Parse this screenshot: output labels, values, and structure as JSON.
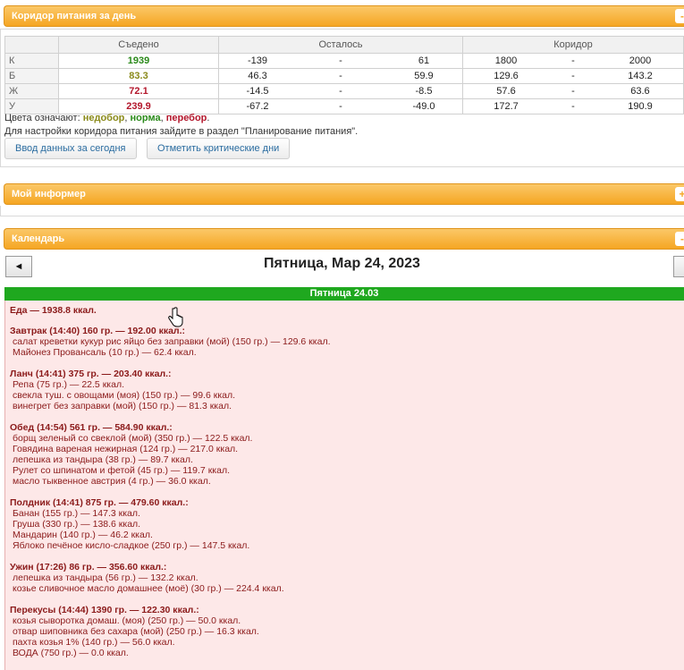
{
  "corridor_panel": {
    "title": "Коридор питания за день",
    "toggle": "-",
    "headers": [
      "Съедено",
      "Осталось",
      "Коридор"
    ],
    "rows": [
      {
        "label": "К",
        "eaten": "1939",
        "eaten_color": "#2a8a1a",
        "left_from": "-139",
        "sep1": "-",
        "left_to": "61",
        "corr_from": "1800",
        "sep2": "-",
        "corr_to": "2000"
      },
      {
        "label": "Б",
        "eaten": "83.3",
        "eaten_color": "#8a8a1a",
        "left_from": "46.3",
        "sep1": "-",
        "left_to": "59.9",
        "corr_from": "129.6",
        "sep2": "-",
        "corr_to": "143.2"
      },
      {
        "label": "Ж",
        "eaten": "72.1",
        "eaten_color": "#b3172c",
        "left_from": "-14.5",
        "sep1": "-",
        "left_to": "-8.5",
        "corr_from": "57.6",
        "sep2": "-",
        "corr_to": "63.6"
      },
      {
        "label": "У",
        "eaten": "239.9",
        "eaten_color": "#b3172c",
        "left_from": "-67.2",
        "sep1": "-",
        "left_to": "-49.0",
        "corr_from": "172.7",
        "sep2": "-",
        "corr_to": "190.9"
      }
    ],
    "legend_prefix": "Цвета означают: ",
    "legend_under": "недобор",
    "legend_sep1": ", ",
    "legend_norm": "норма",
    "legend_sep2": ", ",
    "legend_over": "перебор",
    "legend_end": ".",
    "settings_note": "Для настройки коридора питания зайдите в раздел \"Планирование питания\".",
    "btn_today": "Ввод данных за сегодня",
    "btn_critical": "Отметить критические дни"
  },
  "informer_panel": {
    "title": "Мой информер",
    "toggle": "+"
  },
  "calendar_panel": {
    "title": "Календарь",
    "toggle": "-",
    "prev": "◄",
    "date_title": "Пятница, Мар 24, 2023",
    "day_label": "Пятница 24.03",
    "total": "Еда — 1938.8 ккал.",
    "meals": [
      {
        "title": "Завтрак (14:40) 160 гр. — 192.00 ккал.:",
        "items": [
          "салат креветки кукур рис яйцо без заправки (мой) (150 гр.) — 129.6 ккал.",
          "Майонез Провансаль (10 гр.) — 62.4 ккал."
        ]
      },
      {
        "title": "Ланч (14:41) 375 гр. — 203.40 ккал.:",
        "items": [
          "Репа (75 гр.) — 22.5 ккал.",
          "свекла туш. с овощами (моя) (150 гр.) — 99.6 ккал.",
          "винегрет без заправки (мой) (150 гр.) — 81.3 ккал."
        ]
      },
      {
        "title": "Обед (14:54) 561 гр. — 584.90 ккал.:",
        "items": [
          "борщ зеленый со свеклой (мой) (350 гр.) — 122.5 ккал.",
          "Говядина вареная нежирная (124 гр.) — 217.0 ккал.",
          "лепешка из тандыра (38 гр.) — 89.7 ккал.",
          "Рулет со шпинатом и фетой (45 гр.) — 119.7 ккал.",
          "масло тыквенное австрия (4 гр.) — 36.0 ккал."
        ]
      },
      {
        "title": "Полдник (14:41) 875 гр. — 479.60 ккал.:",
        "items": [
          "Банан (155 гр.) — 147.3 ккал.",
          "Груша (330 гр.) — 138.6 ккал.",
          "Мандарин (140 гр.) — 46.2 ккал.",
          "Яблоко печёное кисло-сладкое (250 гр.) — 147.5 ккал."
        ]
      },
      {
        "title": "Ужин (17:26) 86 гр. — 356.60 ккал.:",
        "items": [
          "лепешка из тандыра (56 гр.) — 132.2 ккал.",
          "козье сливочное масло домашнее (моё) (30 гр.) — 224.4 ккал."
        ]
      },
      {
        "title": "Перекусы (14:44) 1390 гр. — 122.30 ккал.:",
        "items": [
          "козья сыворотка домаш. (моя) (250 гр.) — 50.0 ккал.",
          "отвар шиповника без сахара (мой) (250 гр.) — 16.3 ккал.",
          "пахта козья 1% (140 гр.) — 56.0 ккал.",
          "ВОДА (750 гр.) — 0.0 ккал."
        ]
      }
    ]
  }
}
